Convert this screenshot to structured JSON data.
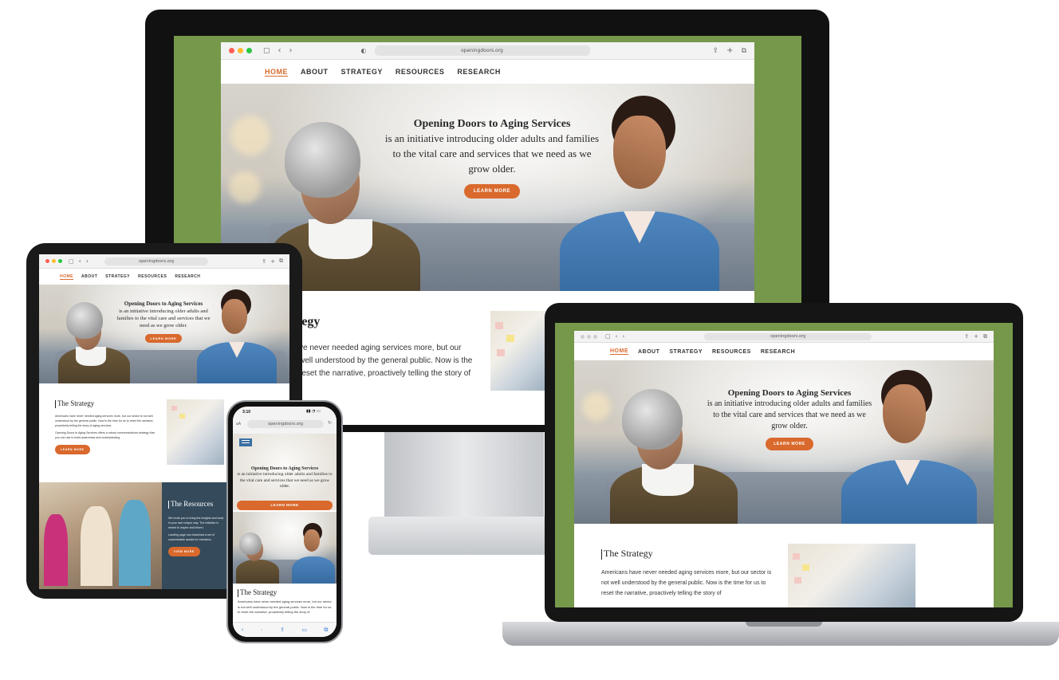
{
  "site": {
    "url": "openingdoors.org",
    "nav": [
      "HOME",
      "ABOUT",
      "STRATEGY",
      "RESOURCES",
      "RESEARCH"
    ],
    "hero_title": "Opening Doors to Aging Services",
    "hero_body": "is an initiative introducing older adults and families to the vital care and services that we need as we grow older.",
    "cta": "LEARN MORE",
    "strategy_title": "The Strategy",
    "strategy_body": "Americans have never needed aging services more, but our sector is not well understood by the general public. Now is the time for us to reset the narrative, proactively telling the story of",
    "monitor_strategy_title": "tegy",
    "monitor_strategy_lines": [
      "ve never needed aging services more, but our",
      "well understood by the general public. Now is the",
      "reset the narrative, proactively telling the story of"
    ],
    "tablet_strategy_body": "Americans have never needed aging services more, but our sector is not well understood by the general public. Now is the time for us to reset the narrative, proactively telling the story of aging services.",
    "tablet_strategy_body2": "Opening Doors to Aging Services offers a robust communications strategy that you can use to build awareness and understanding.",
    "resources_title": "The Resources",
    "resources_body": "We invite you to bring the insights and tools in your own unique way. The initiative is meant to inspire and inform.",
    "resources_body2": "Landing page can download a set of customizable assets for members.",
    "resources_cta": "VIEW MORE",
    "phone_time": "3:10",
    "phone_url": "openingdoors.org"
  },
  "colors": {
    "accent": "#d9692c",
    "green_bg": "#76984a",
    "slate": "#354b5c"
  }
}
